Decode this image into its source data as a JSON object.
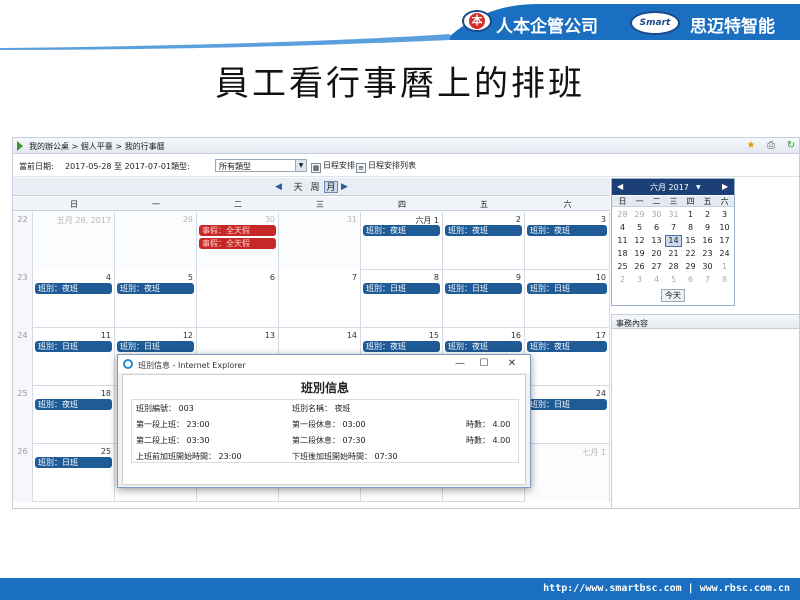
{
  "slide": {
    "title": "員工看行事曆上的排班",
    "company1": "人本企管公司",
    "logo1_text": "本",
    "logo2_text": "Smart",
    "company2": "思迈特智能",
    "footer": "http://www.smartbsc.com  |  www.rbsc.com.cn"
  },
  "app": {
    "breadcrumb": "我的辦公桌 > 個人平臺 > 我的行事曆",
    "toolbar_icons": [
      "star-icon",
      "print-icon",
      "refresh-icon"
    ],
    "filter": {
      "date_label": "當前日期:",
      "date_range": "2017-05-28 至 2017-07-01",
      "type_label": "類型:",
      "type_value": "所有類型",
      "schedule_btn": "日程安排",
      "schedule_list_btn": "日程安排列表"
    },
    "nav": {
      "day": "天",
      "week": "周",
      "month": "月"
    },
    "weekdays": [
      "日",
      "一",
      "二",
      "三",
      "四",
      "五",
      "六"
    ],
    "weeks": [
      {
        "num": "22",
        "days": [
          {
            "label": "五月 28, 2017",
            "other": true,
            "events": []
          },
          {
            "label": "29",
            "other": true,
            "events": []
          },
          {
            "label": "30",
            "other": true,
            "events": [
              {
                "text": "事假：全天假",
                "red": true
              },
              {
                "text": "事假：全天假",
                "red": true
              }
            ]
          },
          {
            "label": "31",
            "other": true,
            "events": []
          },
          {
            "label": "六月 1",
            "other": false,
            "events": [
              {
                "text": "班別：夜班"
              }
            ]
          },
          {
            "label": "2",
            "other": false,
            "events": [
              {
                "text": "班別：夜班"
              }
            ]
          },
          {
            "label": "3",
            "other": false,
            "events": [
              {
                "text": "班別：夜班"
              }
            ]
          }
        ]
      },
      {
        "num": "23",
        "days": [
          {
            "label": "4",
            "events": [
              {
                "text": "班別：夜班"
              }
            ]
          },
          {
            "label": "5",
            "events": [
              {
                "text": "班別：夜班"
              }
            ]
          },
          {
            "label": "6",
            "events": []
          },
          {
            "label": "7",
            "events": []
          },
          {
            "label": "8",
            "events": [
              {
                "text": "班別：日班"
              }
            ]
          },
          {
            "label": "9",
            "events": [
              {
                "text": "班別：日班"
              }
            ]
          },
          {
            "label": "10",
            "events": [
              {
                "text": "班別：日班"
              }
            ]
          }
        ]
      },
      {
        "num": "24",
        "days": [
          {
            "label": "11",
            "events": [
              {
                "text": "班別：日班"
              }
            ]
          },
          {
            "label": "12",
            "events": [
              {
                "text": "班別：日班"
              }
            ]
          },
          {
            "label": "13",
            "events": []
          },
          {
            "label": "14",
            "events": []
          },
          {
            "label": "15",
            "events": [
              {
                "text": "班別：夜班"
              }
            ]
          },
          {
            "label": "16",
            "events": [
              {
                "text": "班別：夜班"
              }
            ]
          },
          {
            "label": "17",
            "events": [
              {
                "text": "班別：夜班"
              }
            ]
          }
        ]
      },
      {
        "num": "25",
        "days": [
          {
            "label": "18",
            "events": [
              {
                "text": "班別：夜班"
              }
            ]
          },
          {
            "label": "",
            "events": []
          },
          {
            "label": "",
            "events": []
          },
          {
            "label": "",
            "events": []
          },
          {
            "label": "",
            "events": []
          },
          {
            "label": "",
            "events": []
          },
          {
            "label": "24",
            "events": [
              {
                "text": "班別：日班"
              }
            ]
          }
        ]
      },
      {
        "num": "26",
        "days": [
          {
            "label": "25",
            "events": [
              {
                "text": "班別：日班"
              }
            ]
          },
          {
            "label": "",
            "events": []
          },
          {
            "label": "",
            "events": []
          },
          {
            "label": "",
            "events": []
          },
          {
            "label": "",
            "events": []
          },
          {
            "label": "",
            "events": []
          },
          {
            "label": "七月 1",
            "other": true,
            "events": []
          }
        ]
      }
    ],
    "mini_cal": {
      "title": "六月 2017",
      "dow": [
        "日",
        "一",
        "二",
        "三",
        "四",
        "五",
        "六"
      ],
      "rows": [
        [
          [
            "28",
            1
          ],
          [
            "29",
            1
          ],
          [
            "30",
            1
          ],
          [
            "31",
            1
          ],
          [
            "1",
            0
          ],
          [
            "2",
            0
          ],
          [
            "3",
            0
          ]
        ],
        [
          [
            "4",
            0
          ],
          [
            "5",
            0
          ],
          [
            "6",
            0
          ],
          [
            "7",
            0
          ],
          [
            "8",
            0
          ],
          [
            "9",
            0
          ],
          [
            "10",
            0
          ]
        ],
        [
          [
            "11",
            0
          ],
          [
            "12",
            0
          ],
          [
            "13",
            0
          ],
          [
            "14",
            2
          ],
          [
            "15",
            0
          ],
          [
            "16",
            0
          ],
          [
            "17",
            0
          ]
        ],
        [
          [
            "18",
            0
          ],
          [
            "19",
            0
          ],
          [
            "20",
            0
          ],
          [
            "21",
            0
          ],
          [
            "22",
            0
          ],
          [
            "23",
            0
          ],
          [
            "24",
            0
          ]
        ],
        [
          [
            "25",
            0
          ],
          [
            "26",
            0
          ],
          [
            "27",
            0
          ],
          [
            "28",
            0
          ],
          [
            "29",
            0
          ],
          [
            "30",
            0
          ],
          [
            "1",
            1
          ]
        ],
        [
          [
            "2",
            1
          ],
          [
            "3",
            1
          ],
          [
            "4",
            1
          ],
          [
            "5",
            1
          ],
          [
            "6",
            1
          ],
          [
            "7",
            1
          ],
          [
            "8",
            1
          ]
        ]
      ],
      "today_btn": "今天"
    },
    "panel_title": "事務內容",
    "dialog": {
      "window_title": "班別信息 - Internet Explorer",
      "heading": "班別信息",
      "shift_no": "班別編號： 003",
      "shift_name": "班別名稱： 夜班",
      "work1": "第一段上班： 23:00",
      "rest1": "第一段休息： 03:00",
      "hours1": "時數： 4.00",
      "work2": "第二段上班： 03:30",
      "rest2": "第二段休息： 07:30",
      "hours2": "時數： 4.00",
      "ot_before": "上班前加班開始時間： 23:00",
      "ot_after": "下班後加班開始時間： 07:30"
    }
  },
  "colors": {
    "header_blue": "#1a6fc0",
    "event_blue": "#1f5b96",
    "event_red": "#c62828",
    "mini_header": "#1c3f78"
  }
}
